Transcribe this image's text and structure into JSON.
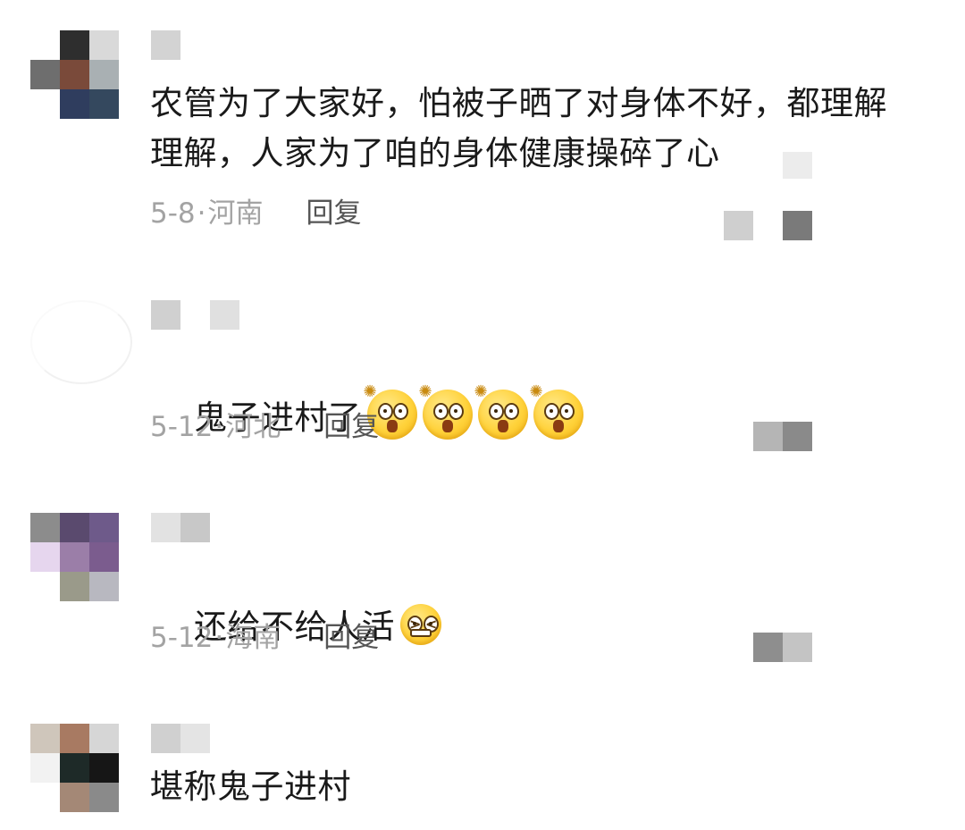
{
  "comments": [
    {
      "text": "农管为了大家好，怕被子晒了对身体不好，都理解理解，人家为了咱的身体健康操碎了心",
      "date": "5-8",
      "location": "河南",
      "reply_label": "回复"
    },
    {
      "text": "鬼子进村了",
      "emojis": [
        "shocked-face-emoji",
        "shocked-face-emoji",
        "shocked-face-emoji",
        "shocked-face-emoji"
      ],
      "date": "5-12",
      "location": "河北",
      "reply_label": "回复"
    },
    {
      "text": "还给不给人活",
      "emojis": [
        "tight-face-emoji"
      ],
      "date": "5-12",
      "location": "海南",
      "reply_label": "回复"
    },
    {
      "text": "堪称鬼子进村"
    }
  ],
  "separator": "·",
  "colors": {
    "text": "#1a1a1a",
    "meta": "#a3a3a3",
    "reply": "#555555",
    "emoji_yellow": "#ffd23a"
  }
}
